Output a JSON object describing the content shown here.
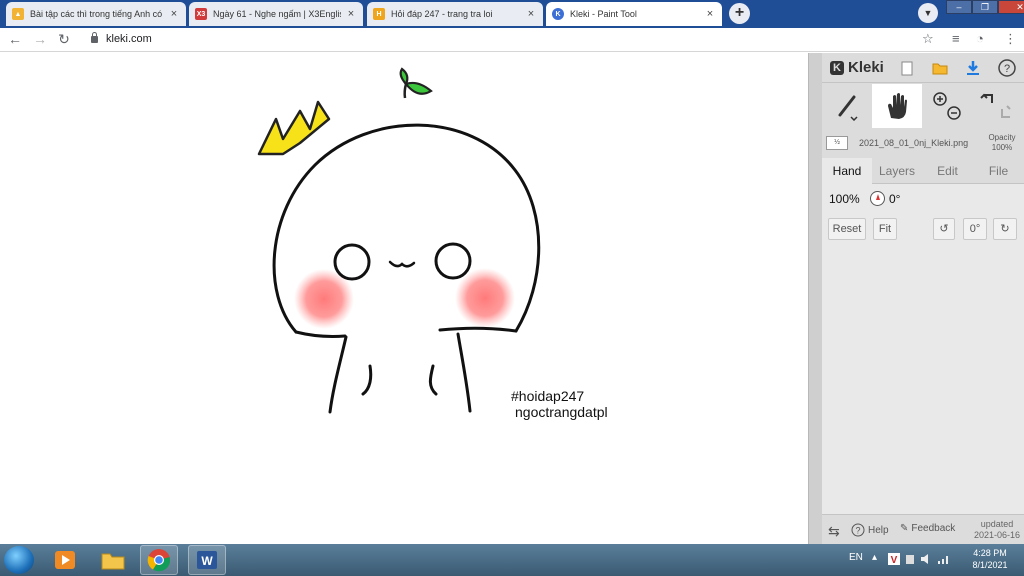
{
  "browser": {
    "tabs": [
      {
        "title": "Bài tập các thì trong tiếng Anh có",
        "active": false,
        "favicon_color": "#f2b233"
      },
      {
        "title": "Ngày 61 - Nghe ngấm | X3English",
        "active": false,
        "favicon_color": "#d23b3b",
        "favicon_text": "X3"
      },
      {
        "title": "Hỏi đáp 247 - trang tra loi",
        "active": false,
        "favicon_color": "#f0a61c",
        "favicon_text": "H"
      },
      {
        "title": "Kleki - Paint Tool",
        "active": true,
        "favicon_color": "#3b6fd6"
      }
    ],
    "close_glyph": "×",
    "new_tab_glyph": "+",
    "url": "kleki.com"
  },
  "canvas": {
    "watermark_line1": "#hoidap247",
    "watermark_line2": "ngoctrangdatpl",
    "crown_color": "#f7e21a",
    "leaf_color": "#3cc63c",
    "blush_color": "#ff7a7a"
  },
  "kleki": {
    "brand": "Kleki",
    "file_name": "2021_08_01_0nj_Kleki.png",
    "opacity_label": "Opacity",
    "opacity_value": "100%",
    "panel_tabs": [
      "Hand",
      "Layers",
      "Edit",
      "File"
    ],
    "active_tab": "Hand",
    "zoom": "100%",
    "angle": "0°",
    "buttons": {
      "reset": "Reset",
      "fit": "Fit",
      "angle_reset": "0°"
    },
    "footer": {
      "help": "Help",
      "feedback": "Feedback",
      "updated_label": "updated",
      "updated_date": "2021-06-16"
    }
  },
  "taskbar": {
    "lang": "EN",
    "time": "4:28 PM",
    "date": "8/1/2021"
  }
}
